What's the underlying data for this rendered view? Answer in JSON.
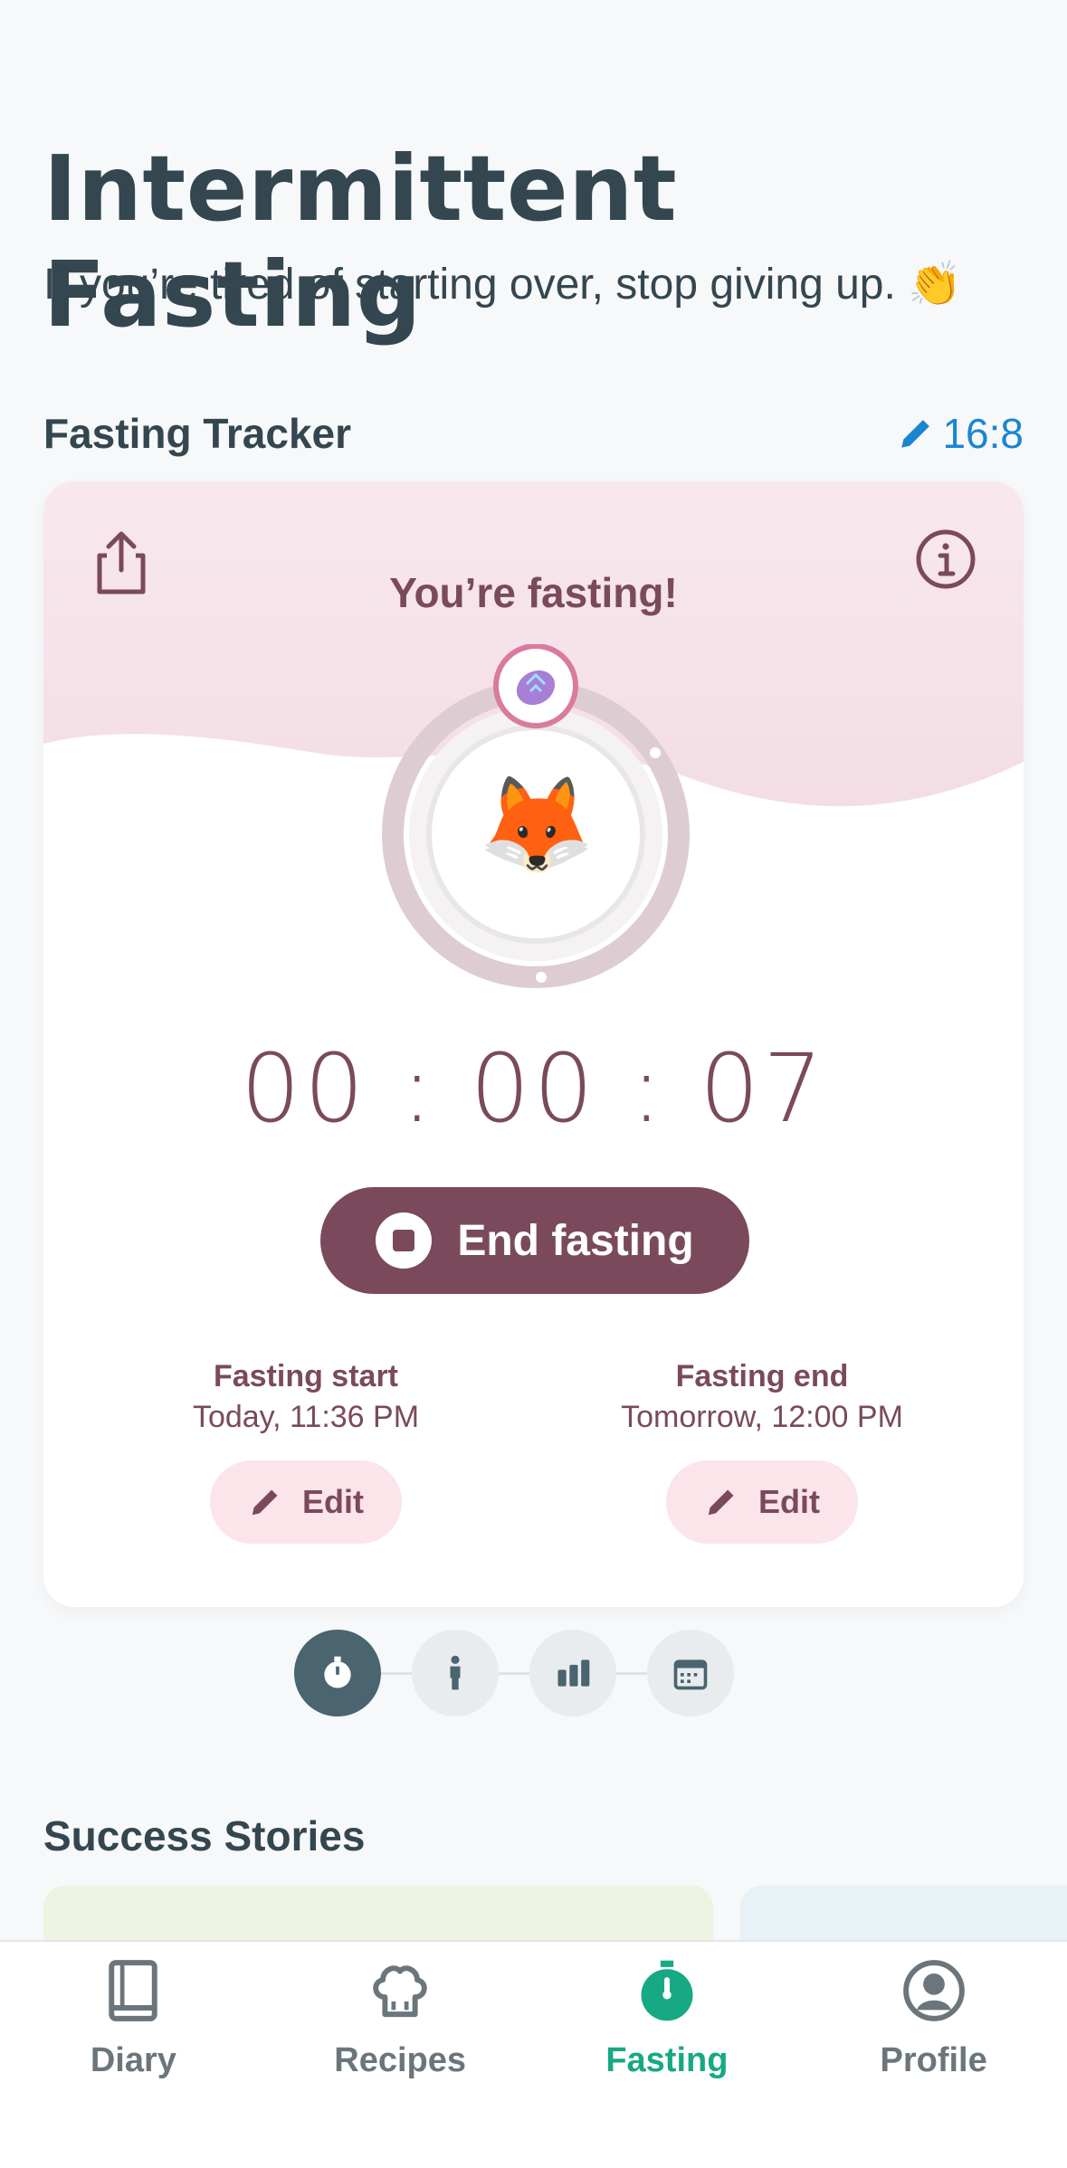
{
  "header": {
    "title": "Intermittent Fasting",
    "subtitle": "If you’re tired of starting over, stop giving up. 👏"
  },
  "tracker": {
    "section_title": "Fasting Tracker",
    "plan": "16:8",
    "status": "You’re fasting!",
    "timer": "00 : 00 : 07",
    "end_button": "End fasting",
    "start": {
      "label": "Fasting start",
      "value": "Today, 11:36 PM",
      "edit": "Edit"
    },
    "end": {
      "label": "Fasting end",
      "value": "Tomorrow, 12:00 PM",
      "edit": "Edit"
    },
    "avatar_emoji": "🦊"
  },
  "stories": {
    "title": "Success Stories"
  },
  "nav": {
    "items": [
      {
        "label": "Diary",
        "icon": "book-icon"
      },
      {
        "label": "Recipes",
        "icon": "chef-hat-icon"
      },
      {
        "label": "Fasting",
        "icon": "stopwatch-icon"
      },
      {
        "label": "Profile",
        "icon": "user-icon"
      }
    ],
    "active": "Fasting"
  },
  "colors": {
    "primary": "#7a4a5c",
    "accent_blue": "#1a86d0",
    "active_green": "#17a884",
    "pink_bg": "#fbe4ea"
  }
}
